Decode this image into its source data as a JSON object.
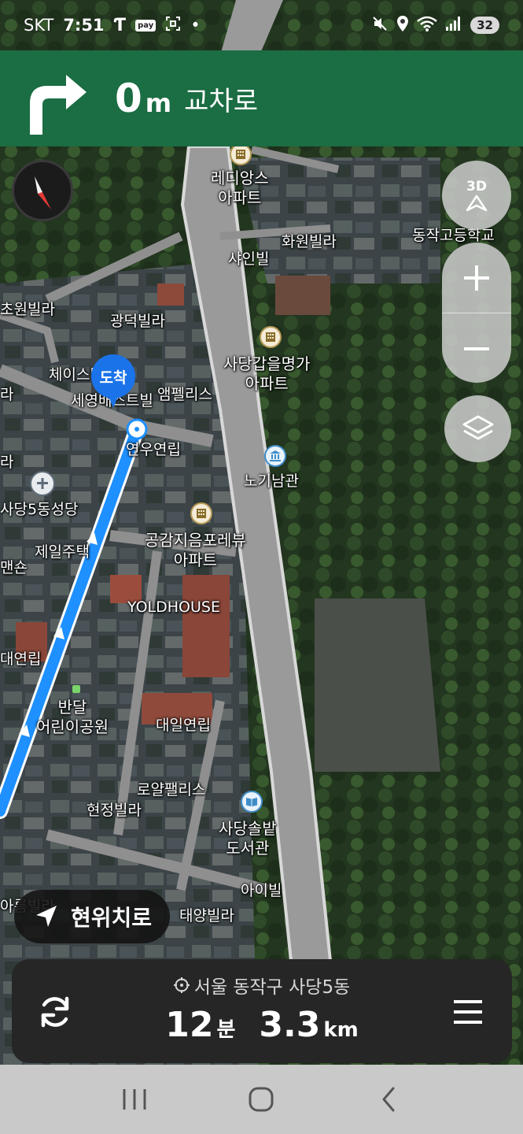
{
  "status_bar": {
    "carrier": "SKT",
    "time": "7:51",
    "pay_badge": "pay",
    "battery": "32"
  },
  "guidance": {
    "distance_value": "0",
    "distance_unit": "m",
    "road_name": "교차로",
    "turn_icon": "turn-right-arrow"
  },
  "map": {
    "labels": {
      "redians": "레디앙스\n아파트",
      "hwawon": "화원빌라",
      "shine": "샤인빌",
      "dongjak_high": "동작고등학교",
      "chowon": "초원빌라",
      "gwangdeok": "광덕빌라",
      "chase": "체이스빌",
      "seyoung": "세영배스트빌",
      "ample": "앰펠리스",
      "sadang_gap": "사당갑을명가\n아파트",
      "yeonwoo": "연우연립",
      "nogi": "노기남관",
      "sadang5_church": "사당5동성당",
      "gonggam": "공감지음포레뷰\n아파트",
      "jeil": "제일주택",
      "mansion": "맨숀",
      "yoldhouse": "YOLDHOUSE",
      "dae_yeonrip": "대연립",
      "bandal": "반달\n어린이공원",
      "daeil": "대일연립",
      "royal": "로얄팰리스",
      "hyunjung": "현정빌라",
      "library": "사당솔밭\n도서관",
      "ai": "아이빌",
      "areum": "아름빌라",
      "taeyang": "태양빌라",
      "left_ra": "라",
      "left_ra2": "라"
    },
    "arrival_marker": "도착"
  },
  "controls": {
    "three_d_label": "3D",
    "recenter_label": "현위치로"
  },
  "info_panel": {
    "destination": "서울 동작구 사당5동",
    "time_value": "12",
    "time_unit": "분",
    "distance_value": "3.3",
    "distance_unit": "km"
  },
  "colors": {
    "guidance_bg": "#1b6d43",
    "route": "#1e90ff",
    "marker": "#1a73e8"
  }
}
